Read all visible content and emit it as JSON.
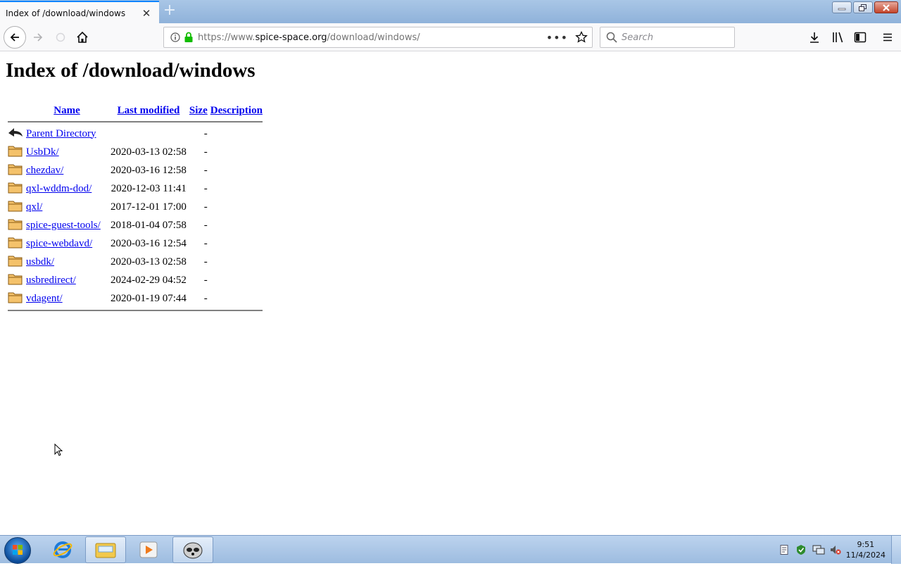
{
  "browser": {
    "tab_title": "Index of /download/windows",
    "url_prefix": "https://www.",
    "url_host": "spice-space.org",
    "url_path": "/download/windows/",
    "search_placeholder": "Search"
  },
  "page": {
    "heading": "Index of /download/windows",
    "columns": {
      "name": "Name",
      "modified": "Last modified",
      "size": "Size",
      "description": "Description"
    },
    "parent": {
      "name": "Parent Directory",
      "modified": "",
      "size": "-"
    },
    "rows": [
      {
        "name": "UsbDk/",
        "modified": "2020-03-13 02:58",
        "size": "-"
      },
      {
        "name": "chezdav/",
        "modified": "2020-03-16 12:58",
        "size": "-"
      },
      {
        "name": "qxl-wddm-dod/",
        "modified": "2020-12-03 11:41",
        "size": "-"
      },
      {
        "name": "qxl/",
        "modified": "2017-12-01 17:00",
        "size": "-"
      },
      {
        "name": "spice-guest-tools/",
        "modified": "2018-01-04 07:58",
        "size": "-"
      },
      {
        "name": "spice-webdavd/",
        "modified": "2020-03-16 12:54",
        "size": "-"
      },
      {
        "name": "usbdk/",
        "modified": "2020-03-13 02:58",
        "size": "-"
      },
      {
        "name": "usbredirect/",
        "modified": "2024-02-29 04:52",
        "size": "-"
      },
      {
        "name": "vdagent/",
        "modified": "2020-01-19 07:44",
        "size": "-"
      }
    ]
  },
  "taskbar": {
    "time": "9:51",
    "date": "11/4/2024"
  },
  "colors": {
    "link": "#0000ee",
    "accent": "#0a84ff",
    "secure": "#12bc00"
  }
}
